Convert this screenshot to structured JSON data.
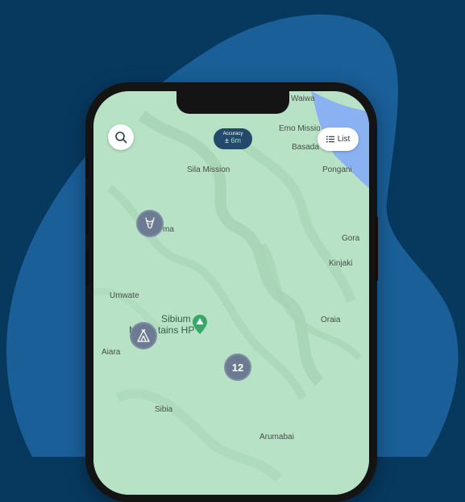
{
  "colors": {
    "background": "#07395f",
    "blob": "#1a5f98",
    "map_land": "#b7e2c5",
    "water": "#8ab2f2",
    "marker": "#6d7b92",
    "accuracy_chip": "#234a6b",
    "park_pin": "#36a867"
  },
  "map": {
    "search_icon": "search-icon",
    "accuracy": {
      "label": "Accuracy",
      "prefix": "±",
      "value": "6m"
    },
    "list_button": {
      "icon": "list-icon",
      "label": "List"
    },
    "places": {
      "waiwa": "Waiwa",
      "emo_mission": "Emo Missio",
      "basada": "Basada",
      "sila_mission": "Sila Mission",
      "pongani": "Pongani",
      "ma": "ma",
      "gora": "Gora",
      "kinjaki": "Kinjaki",
      "umwate": "Umwate",
      "sibium_line1": "Sibium",
      "sibium_line2": "M",
      "sibium_line3": "tains HP",
      "oraia": "Oraia",
      "aiara": "Aiara",
      "sibia": "Sibia",
      "arumabai": "Arumabai"
    },
    "markers": {
      "wildlife_icon": "deer-icon",
      "camping_icon": "tent-icon",
      "cluster_count": "12"
    }
  }
}
